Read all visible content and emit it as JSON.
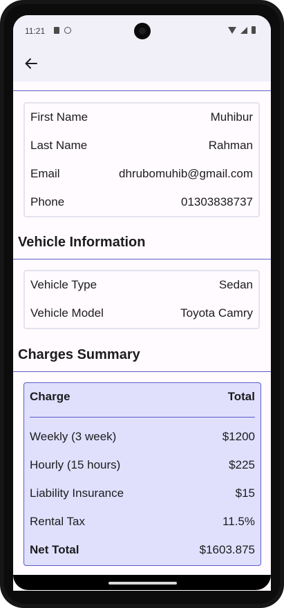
{
  "status": {
    "time": "11:21"
  },
  "personal": {
    "rows": [
      {
        "label": "First Name",
        "value": "Muhibur"
      },
      {
        "label": "Last Name",
        "value": "Rahman"
      },
      {
        "label": "Email",
        "value": "dhrubomuhib@gmail.com"
      },
      {
        "label": "Phone",
        "value": "01303838737"
      }
    ]
  },
  "vehicle": {
    "title": "Vehicle Information",
    "rows": [
      {
        "label": "Vehicle Type",
        "value": "Sedan"
      },
      {
        "label": "Vehicle Model",
        "value": "Toyota Camry"
      }
    ]
  },
  "charges": {
    "title": "Charges Summary",
    "header": {
      "label": "Charge",
      "value": "Total"
    },
    "rows": [
      {
        "label": "Weekly (3 week)",
        "value": "$1200"
      },
      {
        "label": "Hourly (15 hours)",
        "value": "$225"
      },
      {
        "label": "Liability Insurance",
        "value": "$15"
      },
      {
        "label": "Rental Tax",
        "value": "11.5%"
      }
    ],
    "net": {
      "label": "Net Total",
      "value": "$1603.875"
    }
  },
  "icons": {
    "back": "arrow-back-icon"
  },
  "colors": {
    "accent": "#5b5bc9",
    "charges_bg": "#e0e0fd",
    "appbar_bg": "#f1eff8"
  }
}
